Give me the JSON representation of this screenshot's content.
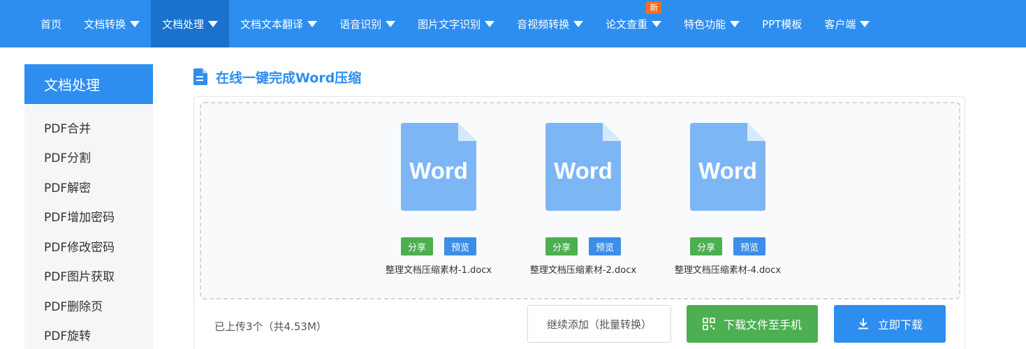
{
  "nav": {
    "items": [
      {
        "label": "首页",
        "dropdown": false
      },
      {
        "label": "文档转换",
        "dropdown": true
      },
      {
        "label": "文档处理",
        "dropdown": true,
        "active": true
      },
      {
        "label": "文档文本翻译",
        "dropdown": true
      },
      {
        "label": "语音识别",
        "dropdown": true
      },
      {
        "label": "图片文字识别",
        "dropdown": true
      },
      {
        "label": "音视频转换",
        "dropdown": true
      },
      {
        "label": "论文查重",
        "dropdown": true,
        "badge": "新"
      },
      {
        "label": "特色功能",
        "dropdown": true
      },
      {
        "label": "PPT模板",
        "dropdown": false
      },
      {
        "label": "客户端",
        "dropdown": true
      }
    ]
  },
  "sidebar": {
    "title": "文档处理",
    "items": [
      {
        "label": "PDF合并"
      },
      {
        "label": "PDF分割"
      },
      {
        "label": "PDF解密"
      },
      {
        "label": "PDF增加密码"
      },
      {
        "label": "PDF修改密码"
      },
      {
        "label": "PDF图片获取"
      },
      {
        "label": "PDF删除页"
      },
      {
        "label": "PDF旋转"
      }
    ]
  },
  "section": {
    "title": "在线一键完成Word压缩",
    "icon": "document-icon"
  },
  "files": [
    {
      "icon_text": "Word",
      "share_label": "分享",
      "preview_label": "预览",
      "name": "整理文档压缩素材-1.docx"
    },
    {
      "icon_text": "Word",
      "share_label": "分享",
      "preview_label": "预览",
      "name": "整理文档压缩素材-2.docx"
    },
    {
      "icon_text": "Word",
      "share_label": "分享",
      "preview_label": "预览",
      "name": "整理文档压缩素材-4.docx"
    }
  ],
  "footer": {
    "upload_status": "已上传3个（共4.53M）",
    "continue_label": "继续添加（批量转换）",
    "phone_label": "下载文件至手机",
    "download_label": "立即下载"
  },
  "colors": {
    "brand": "#2d8ef0",
    "brand_dark": "#1a72cc",
    "green": "#4caf50",
    "word_icon": "#7db6f5",
    "badge": "#ff6a1a"
  }
}
